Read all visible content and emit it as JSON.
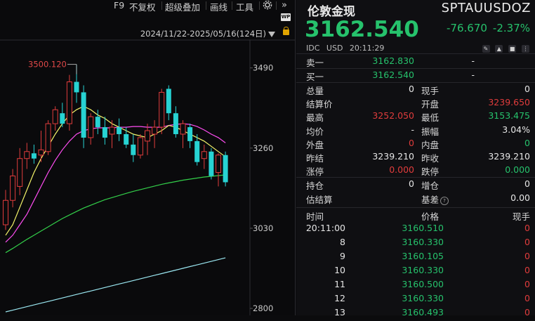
{
  "toolbar": {
    "items": [
      "F9",
      "不复权",
      "超级叠加",
      "画线",
      "工具"
    ],
    "settings_icon": "gear-icon",
    "expand_icon": "double-chevron-right-icon",
    "wp_badge": "WP",
    "date_range": "2024/11/22-2025/05/16(124日)"
  },
  "chart_data": {
    "type": "candlestick",
    "y_ticks": [
      "3490",
      "3260",
      "3030",
      "2800"
    ],
    "y_tick_values": [
      3490,
      3260,
      3030,
      2800
    ],
    "ylim": [
      2780,
      3570
    ],
    "annotation": "3500.120",
    "annotation_value": 3500.12,
    "candles": [
      {
        "o": 3040,
        "h": 3140,
        "l": 3025,
        "c": 3110
      },
      {
        "o": 3110,
        "h": 3200,
        "l": 3090,
        "c": 3180
      },
      {
        "o": 3150,
        "h": 3260,
        "l": 3125,
        "c": 3230
      },
      {
        "o": 3230,
        "h": 3275,
        "l": 3200,
        "c": 3250
      },
      {
        "o": 3245,
        "h": 3270,
        "l": 3215,
        "c": 3230
      },
      {
        "o": 3240,
        "h": 3310,
        "l": 3220,
        "c": 3255
      },
      {
        "o": 3250,
        "h": 3340,
        "l": 3240,
        "c": 3330
      },
      {
        "o": 3330,
        "h": 3380,
        "l": 3310,
        "c": 3370
      },
      {
        "o": 3360,
        "h": 3390,
        "l": 3320,
        "c": 3330
      },
      {
        "o": 3330,
        "h": 3470,
        "l": 3310,
        "c": 3450
      },
      {
        "o": 3450,
        "h": 3500,
        "l": 3390,
        "c": 3420
      },
      {
        "o": 3420,
        "h": 3440,
        "l": 3260,
        "c": 3290
      },
      {
        "o": 3290,
        "h": 3360,
        "l": 3270,
        "c": 3350
      },
      {
        "o": 3350,
        "h": 3370,
        "l": 3300,
        "c": 3320
      },
      {
        "o": 3320,
        "h": 3350,
        "l": 3270,
        "c": 3290
      },
      {
        "o": 3300,
        "h": 3340,
        "l": 3260,
        "c": 3320
      },
      {
        "o": 3320,
        "h": 3345,
        "l": 3280,
        "c": 3300
      },
      {
        "o": 3300,
        "h": 3320,
        "l": 3260,
        "c": 3270
      },
      {
        "o": 3270,
        "h": 3300,
        "l": 3220,
        "c": 3240
      },
      {
        "o": 3240,
        "h": 3300,
        "l": 3230,
        "c": 3290
      },
      {
        "o": 3280,
        "h": 3330,
        "l": 3240,
        "c": 3310
      },
      {
        "o": 3300,
        "h": 3340,
        "l": 3260,
        "c": 3320
      },
      {
        "o": 3320,
        "h": 3430,
        "l": 3300,
        "c": 3420
      },
      {
        "o": 3430,
        "h": 3440,
        "l": 3340,
        "c": 3360
      },
      {
        "o": 3360,
        "h": 3380,
        "l": 3290,
        "c": 3300
      },
      {
        "o": 3300,
        "h": 3340,
        "l": 3260,
        "c": 3330
      },
      {
        "o": 3320,
        "h": 3330,
        "l": 3260,
        "c": 3280
      },
      {
        "o": 3280,
        "h": 3300,
        "l": 3210,
        "c": 3220
      },
      {
        "o": 3230,
        "h": 3270,
        "l": 3200,
        "c": 3250
      },
      {
        "o": 3250,
        "h": 3260,
        "l": 3170,
        "c": 3180
      },
      {
        "o": 3190,
        "h": 3245,
        "l": 3150,
        "c": 3240
      },
      {
        "o": 3240,
        "h": 3250,
        "l": 3150,
        "c": 3162
      }
    ],
    "colors": {
      "up": "#e03c3c",
      "down": "#27d3d3",
      "ma5": "#f5f56a",
      "ma10": "#ff4df2",
      "ma20": "#33d04a",
      "ma60": "#9be8f2"
    },
    "ma5": [
      3010,
      3040,
      3090,
      3140,
      3190,
      3230,
      3265,
      3300,
      3330,
      3355,
      3370,
      3380,
      3370,
      3355,
      3345,
      3330,
      3320,
      3310,
      3300,
      3295,
      3290,
      3300,
      3310,
      3325,
      3320,
      3310,
      3300,
      3290,
      3280,
      3265,
      3250,
      3235
    ],
    "ma10": [
      2990,
      3010,
      3040,
      3070,
      3110,
      3150,
      3190,
      3225,
      3255,
      3280,
      3300,
      3310,
      3315,
      3318,
      3318,
      3318,
      3320,
      3320,
      3322,
      3322,
      3320,
      3320,
      3320,
      3325,
      3328,
      3330,
      3328,
      3322,
      3312,
      3300,
      3290,
      3275
    ],
    "ma20": [
      2960,
      2972,
      2985,
      2998,
      3010,
      3022,
      3034,
      3046,
      3058,
      3068,
      3078,
      3088,
      3096,
      3104,
      3112,
      3118,
      3124,
      3130,
      3136,
      3141,
      3146,
      3151,
      3156,
      3160,
      3164,
      3168,
      3171,
      3174,
      3177,
      3179,
      3181,
      3183
    ],
    "ma60": [
      2790,
      2795,
      2800,
      2805,
      2810,
      2815,
      2820,
      2825,
      2830,
      2835,
      2840,
      2845,
      2850,
      2855,
      2860,
      2865,
      2870,
      2875,
      2880,
      2885,
      2890,
      2895,
      2900,
      2905,
      2910,
      2915,
      2920,
      2925,
      2930,
      2935,
      2940,
      2945
    ]
  },
  "quote": {
    "name": "伦敦金现",
    "code": "SPTAUUSDOZ",
    "price": "3162.540",
    "change": "-76.670",
    "change_pct": "-2.37%",
    "meta": [
      "IDC",
      "USD",
      "20:11:29"
    ],
    "ask_label": "卖一",
    "ask_price": "3162.830",
    "ask_vol": "-",
    "bid_label": "买一",
    "bid_price": "3162.540",
    "bid_vol": "-"
  },
  "stats": [
    {
      "l1": "总量",
      "v1": "0",
      "c1": "",
      "l2": "现手",
      "v2": "0",
      "c2": ""
    },
    {
      "l1": "结算价",
      "v1": "",
      "c1": "",
      "l2": "开盘",
      "v2": "3239.650",
      "c2": "red"
    },
    {
      "l1": "最高",
      "v1": "3252.050",
      "c1": "red",
      "l2": "最低",
      "v2": "3153.475",
      "c2": "green"
    },
    {
      "l1": "均价",
      "v1": "-",
      "c1": "",
      "l2": "振幅",
      "v2": "3.04%",
      "c2": ""
    },
    {
      "l1": "外盘",
      "v1": "0",
      "c1": "red",
      "l2": "内盘",
      "v2": "0",
      "c2": "green"
    },
    {
      "l1": "昨结",
      "v1": "3239.210",
      "c1": "",
      "l2": "昨收",
      "v2": "3239.210",
      "c2": ""
    },
    {
      "l1": "涨停",
      "v1": "0.000",
      "c1": "red",
      "l2": "跌停",
      "v2": "0.000",
      "c2": "green"
    }
  ],
  "stats2": [
    {
      "l1": "持仓",
      "v1": "0",
      "l2": "增仓",
      "v2": "0"
    },
    {
      "l1": "估结算",
      "v1": "",
      "l2": "基差",
      "v2": "0.00"
    }
  ],
  "ticks": {
    "headers": [
      "时间",
      "价格",
      "现手"
    ],
    "rows": [
      {
        "t": "20:11:00",
        "p": "3160.510",
        "v": "0"
      },
      {
        "t": "8",
        "p": "3160.330",
        "v": "0"
      },
      {
        "t": "9",
        "p": "3160.105",
        "v": "0"
      },
      {
        "t": "10",
        "p": "3160.330",
        "v": "0"
      },
      {
        "t": "11",
        "p": "3160.500",
        "v": "0"
      },
      {
        "t": "12",
        "p": "3160.330",
        "v": "0"
      },
      {
        "t": "13",
        "p": "3160.493",
        "v": "0"
      }
    ]
  }
}
